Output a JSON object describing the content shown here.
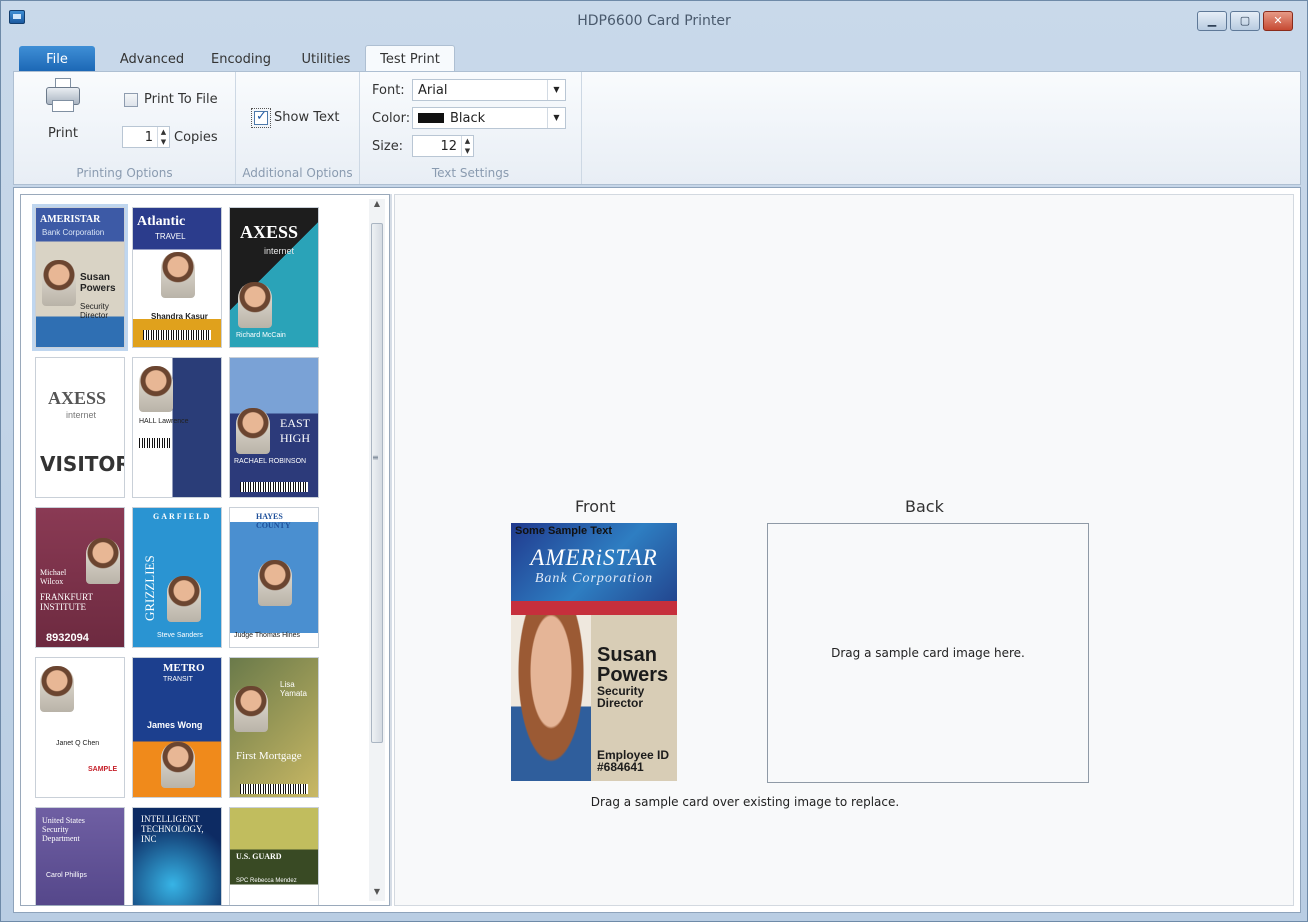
{
  "window": {
    "title": "HDP6600 Card Printer"
  },
  "tabs": [
    "File",
    "Advanced",
    "Encoding",
    "Utilities",
    "Test Print"
  ],
  "ribbon": {
    "printing_options": {
      "print_label": "Print",
      "print_to_file_label": "Print To File",
      "print_to_file_checked": false,
      "copies_value": "1",
      "copies_label": "Copies",
      "group_label": "Printing Options"
    },
    "additional_options": {
      "show_text_label": "Show Text",
      "show_text_checked": true,
      "group_label": "Additional Options"
    },
    "text_settings": {
      "font_label": "Font:",
      "font_value": "Arial",
      "color_label": "Color:",
      "color_value": "Black",
      "color_swatch": "#111111",
      "size_label": "Size:",
      "size_value": "12",
      "group_label": "Text Settings"
    }
  },
  "gallery": {
    "cards": [
      {
        "title": "AMERISTAR",
        "line1": "Bank Corporation",
        "name": "Susan Powers",
        "role": "Security Director"
      },
      {
        "title": "Atlantic",
        "line1": "TRAVEL",
        "name": "Shandra Kasur"
      },
      {
        "title": "AXESS",
        "line1": "internet",
        "name": "Richard McCain"
      },
      {
        "title": "AXESS",
        "line1": "internet",
        "big": "VISITOR"
      },
      {
        "name": "HALL Lawrence"
      },
      {
        "name": "RACHAEL ROBINSON",
        "line1": "EAST HIGH"
      },
      {
        "name": "Michael Wilcox",
        "line1": "FRANKFURT INSTITUTE",
        "big": "8932094"
      },
      {
        "title": "GARFIELD",
        "line1": "GRIZZLIES",
        "name": "Steve Sanders"
      },
      {
        "title": "HAYES COUNTY",
        "name": "Judge Thomas Hines"
      },
      {
        "name": "Janet Q Chen",
        "line1": "SAMPLE"
      },
      {
        "title": "METRO",
        "line1": "TRANSIT",
        "name": "James Wong"
      },
      {
        "name": "Lisa Yamata",
        "line1": "First Mortgage"
      },
      {
        "title": "United States Security Department",
        "name": "Carol Phillips"
      },
      {
        "title": "INTELLIGENT TECHNOLOGY, INC"
      },
      {
        "title": "U.S. GUARD",
        "name": "SPC Rebecca Mendez"
      }
    ]
  },
  "preview": {
    "front_label": "Front",
    "back_label": "Back",
    "front_card": {
      "sample_text": "Some Sample Text",
      "brand": "AMERiSTAR",
      "brand_sub": "Bank Corporation",
      "first_name": "Susan",
      "last_name": "Powers",
      "role1": "Security",
      "role2": "Director",
      "emp_label": "Employee ID",
      "emp_id": "#684641"
    },
    "back_hint": "Drag a sample card image here.",
    "replace_hint": "Drag a sample card over existing image to replace."
  }
}
